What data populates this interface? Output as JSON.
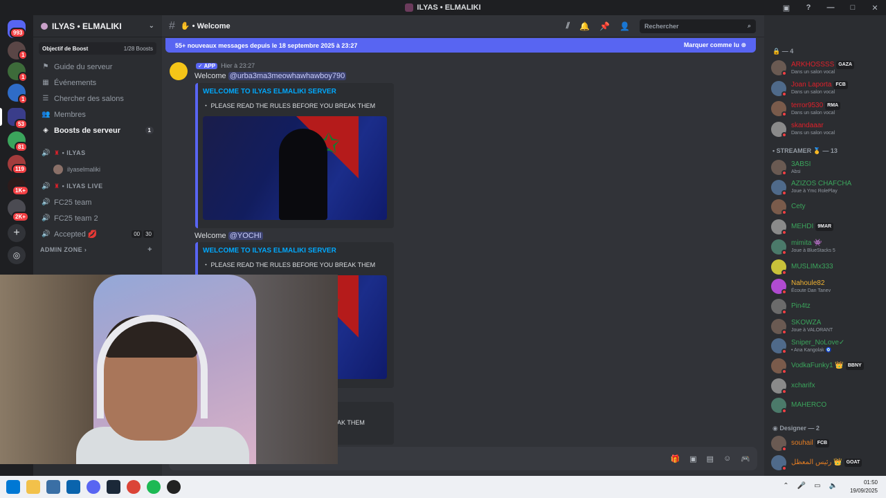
{
  "window": {
    "title": "ILYAS • ELMALIKI"
  },
  "rail": {
    "badges": [
      "993",
      "1",
      "1",
      "1",
      "53",
      "81",
      "119",
      "1K+",
      "2K+"
    ]
  },
  "server": {
    "name": "ILYAS • ELMALIKI",
    "boost_goal": "Objectif de Boost",
    "boost_count": "1/28 Boosts",
    "nav": [
      {
        "label": "Guide du serveur"
      },
      {
        "label": "Événements"
      },
      {
        "label": "Chercher des salons"
      },
      {
        "label": "Membres"
      },
      {
        "label": "Boosts de serveur",
        "badge": "1"
      }
    ],
    "voice1": "ILYAS",
    "voice1_user": "ilyaselmaliki",
    "voice2": "ILYAS LIVE",
    "channels": [
      {
        "label": "FC25 team"
      },
      {
        "label": "FC25 team 2"
      },
      {
        "label": "Accepted 💋"
      }
    ],
    "accepted_counts": [
      "00",
      "30"
    ],
    "admin_zone": "ADMIN ZONE"
  },
  "chat": {
    "channel": "✋ • Welcome",
    "search_placeholder": "Rechercher",
    "banner_text": "55+ nouveaux messages depuis le 18 septembre 2025 à 23:27",
    "banner_action": "Marquer comme lu",
    "app_badge": "✓ APP",
    "timestamp": "Hier à 23:27",
    "welcome": "Welcome",
    "mention1": "@urba3ma3meowhawhawboy790",
    "mention2": "@YOCHI",
    "embed_title": "WELCOME TO ILYAS ELMALIKI SERVER",
    "embed_desc": "・ PLEASE READ THE RULES BEFORE YOU BREAK THEM",
    "embed_desc_fragment": "EAK THEM"
  },
  "members": {
    "group_voice": "— 4",
    "voice_members": [
      {
        "name": "ARKHOSSSS",
        "tag": "GAZA",
        "status": "Dans un salon vocal",
        "color": "#e0202a"
      },
      {
        "name": "Joan Laporta",
        "tag": "FCB",
        "status": "Dans un salon vocal",
        "color": "#e0202a"
      },
      {
        "name": "terror9530",
        "tag": "RMA",
        "status": "Dans un salon vocal",
        "color": "#e0202a"
      },
      {
        "name": "skandaaar",
        "tag": "",
        "status": "Dans un salon vocal",
        "color": "#e0202a"
      }
    ],
    "group_streamer": "STREAMER 🥇 — 13",
    "streamers": [
      {
        "name": "3ABSI",
        "tag": "",
        "status": "Absi",
        "color": "#3ba55c"
      },
      {
        "name": "AZIZOS CHAFCHA",
        "tag": "",
        "status": "Joue à Ymc RolePlay",
        "color": "#3ba55c"
      },
      {
        "name": "Cety",
        "tag": "",
        "status": "",
        "color": "#3ba55c"
      },
      {
        "name": "MEHDI",
        "tag": "9MAR",
        "status": "",
        "color": "#3ba55c"
      },
      {
        "name": "mimita 👾",
        "tag": "",
        "status": "Joue à BlueStacks 5",
        "color": "#3ba55c"
      },
      {
        "name": "MUSLIMx333",
        "tag": "",
        "status": "",
        "color": "#3ba55c"
      },
      {
        "name": "Nahoule82",
        "tag": "",
        "status": "Écoute Dan Tanev",
        "color": "#f0b232"
      },
      {
        "name": "Pin4tz",
        "tag": "",
        "status": "",
        "color": "#3ba55c"
      },
      {
        "name": "SKOWZA",
        "tag": "",
        "status": "Joue à VALORANT",
        "color": "#3ba55c"
      },
      {
        "name": "Sniper_NoLove✓",
        "tag": "",
        "status": "• Ana Kangolak 🧿",
        "color": "#3ba55c"
      },
      {
        "name": "VodkaFunky1 👑",
        "tag": "BBNY",
        "status": "",
        "color": "#3ba55c"
      },
      {
        "name": "xcharifx",
        "tag": "",
        "status": "",
        "color": "#3ba55c"
      },
      {
        "name": "MAHERCO",
        "tag": "",
        "status": "",
        "color": "#3ba55c"
      }
    ],
    "group_designer": "Designer — 2",
    "designers": [
      {
        "name": "souhail",
        "tag": "FCB",
        "status": "",
        "color": "#e67e22"
      },
      {
        "name": "رئيس المعظل 👑",
        "tag": "GOAT",
        "status": "",
        "color": "#e67e22"
      }
    ]
  },
  "taskbar": {
    "time": "01:50",
    "date": "19/09/2025"
  }
}
